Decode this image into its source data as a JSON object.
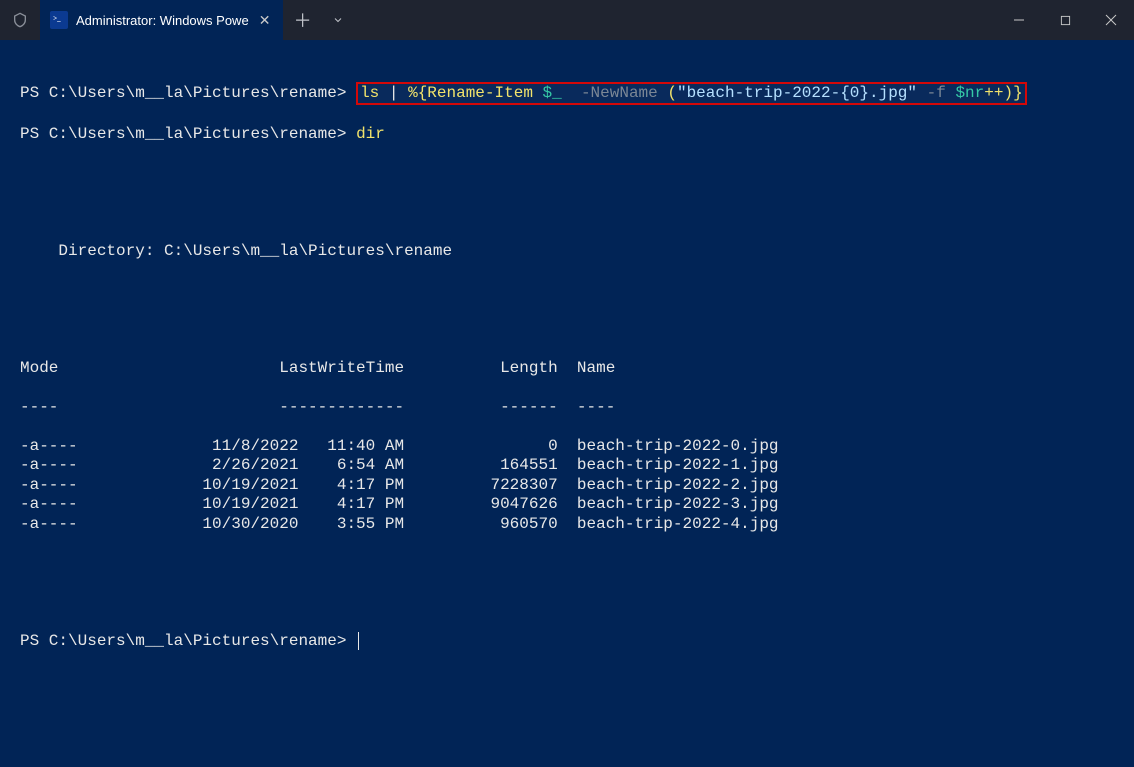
{
  "tab": {
    "title": "Administrator: Windows Powe"
  },
  "prompt": "PS C:\\Users\\m__la\\Pictures\\rename>",
  "cmd1": {
    "ls": "ls",
    "pipe": "|",
    "foreach_open": "%{",
    "rename": "Rename-Item",
    "dollar_underscore": "$_",
    "newname_flag": "-NewName",
    "paren_open": "(",
    "string": "\"beach-trip-2022-{0}.jpg\"",
    "dash_f": "-f",
    "nr": "$nr",
    "plusplus": "++",
    "paren_close": ")",
    "brace_close": "}"
  },
  "cmd2": "dir",
  "dir_header": "    Directory: C:\\Users\\m__la\\Pictures\\rename",
  "cols": {
    "mode": "Mode",
    "lwt": "LastWriteTime",
    "length": "Length",
    "name": "Name"
  },
  "dashes": {
    "mode": "----",
    "lwt": "-------------",
    "length": "------",
    "name": "----"
  },
  "rows": [
    {
      "mode": "-a----",
      "date": "11/8/2022",
      "time": "11:40 AM",
      "length": "0",
      "name": "beach-trip-2022-0.jpg"
    },
    {
      "mode": "-a----",
      "date": "2/26/2021",
      "time": "6:54 AM",
      "length": "164551",
      "name": "beach-trip-2022-1.jpg"
    },
    {
      "mode": "-a----",
      "date": "10/19/2021",
      "time": "4:17 PM",
      "length": "7228307",
      "name": "beach-trip-2022-2.jpg"
    },
    {
      "mode": "-a----",
      "date": "10/19/2021",
      "time": "4:17 PM",
      "length": "9047626",
      "name": "beach-trip-2022-3.jpg"
    },
    {
      "mode": "-a----",
      "date": "10/30/2020",
      "time": "3:55 PM",
      "length": "960570",
      "name": "beach-trip-2022-4.jpg"
    }
  ]
}
